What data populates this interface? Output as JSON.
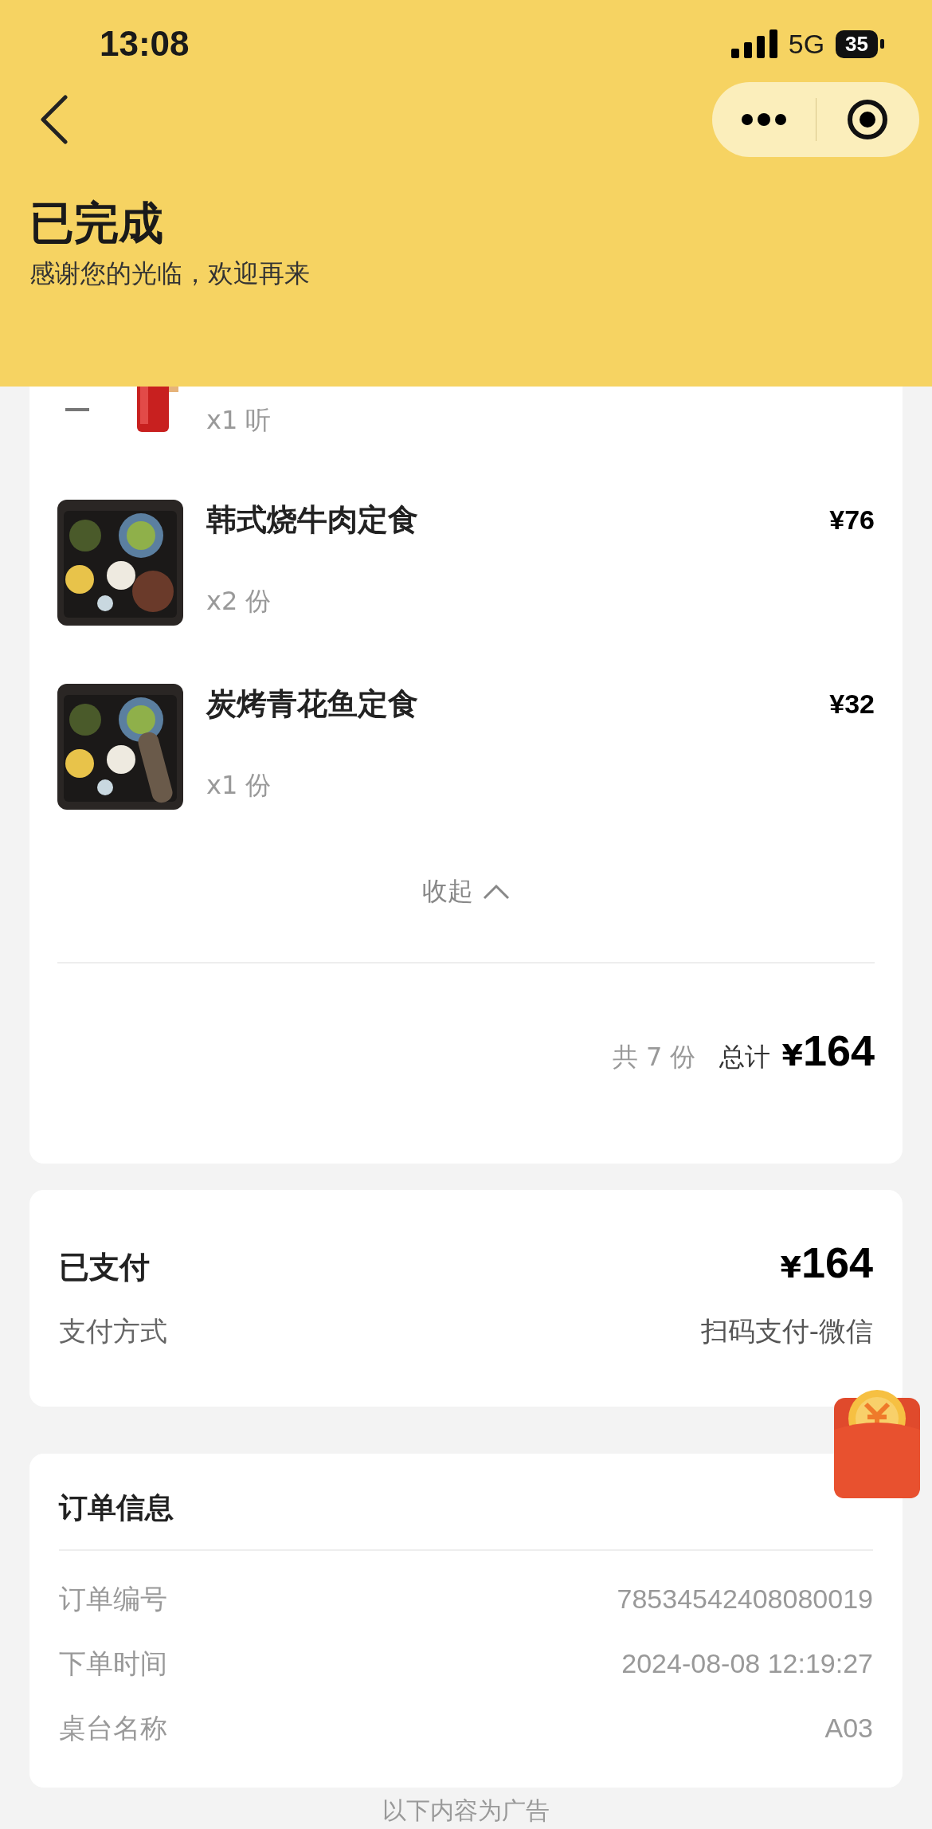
{
  "status_bar": {
    "time": "13:08",
    "network": "5G",
    "battery": "35"
  },
  "header": {
    "title": "已完成",
    "subtitle": "感谢您的光临，欢迎再来"
  },
  "items": [
    {
      "kind": "partial",
      "quantity": "x1 听"
    },
    {
      "kind": "full",
      "name": "韩式烧牛肉定食",
      "price": "¥76",
      "quantity": "x2 份"
    },
    {
      "kind": "full",
      "name": "炭烤青花鱼定食",
      "price": "¥32",
      "quantity": "x1 份"
    }
  ],
  "collapse": {
    "label": "收起",
    "expanded": true
  },
  "summary": {
    "count": "共 7 份",
    "total_label": "总计",
    "currency": "¥",
    "total": "164"
  },
  "payment": {
    "status": "已支付",
    "currency": "¥",
    "amount": "164",
    "method_label": "支付方式",
    "method": "扫码支付-微信"
  },
  "order_info": {
    "title": "订单信息",
    "rows": [
      {
        "label": "订单编号",
        "value": "78534542408080019"
      },
      {
        "label": "下单时间",
        "value": "2024-08-08 12:19:27"
      },
      {
        "label": "桌台名称",
        "value": "A03"
      }
    ]
  },
  "ad_notice": "以下内容为广告"
}
